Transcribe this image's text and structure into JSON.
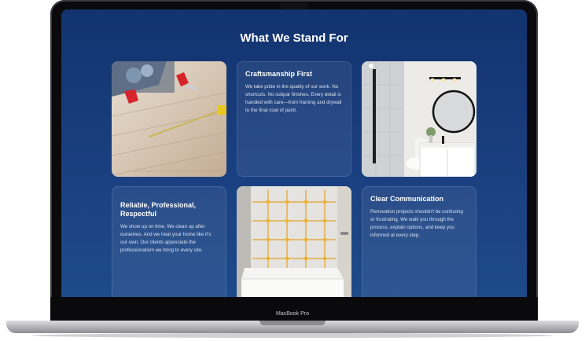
{
  "device": {
    "label": "MacBook Pro"
  },
  "section": {
    "title": "What We Stand For"
  },
  "cards": [
    {
      "title": "Craftsmanship First",
      "body": "We take pride in the quality of our work. No shortcuts. No subpar finishes. Every detail is handled with care—from framing and drywall to the final coat of paint."
    },
    {
      "title": "Reliable, Professional, Respectful",
      "body": "We show up on time. We clean up after ourselves. And we treat your home like it's our own. Our clients appreciate the professionalism we bring to every site."
    },
    {
      "title": "Clear Communication",
      "body": "Renovation projects shouldn't be confusing or frustrating. We walk you through the process, explain options, and keep you informed at every step."
    }
  ],
  "images": [
    {
      "name": "flooring-installation-photo"
    },
    {
      "name": "bathroom-shower-vanity-photo"
    },
    {
      "name": "tile-shower-leveling-photo"
    }
  ]
}
